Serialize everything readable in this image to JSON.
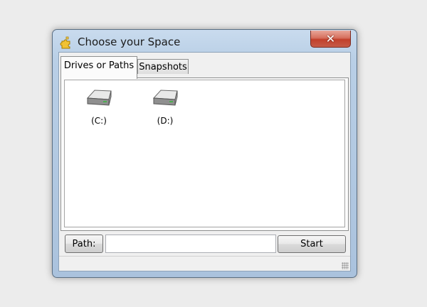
{
  "window": {
    "title": "Choose your Space",
    "close_symbol": "✕",
    "app_icon": "puzzle-piece-icon"
  },
  "tabs": [
    {
      "label": "Drives or Paths",
      "active": true
    },
    {
      "label": "Snapshots",
      "active": false
    }
  ],
  "drives": [
    {
      "label": "(C:)",
      "icon": "hard-drive-icon"
    },
    {
      "label": "(D:)",
      "icon": "hard-drive-icon"
    }
  ],
  "path": {
    "button_label": "Path:",
    "value": "",
    "placeholder": ""
  },
  "start_button": {
    "label": "Start"
  },
  "colors": {
    "titlebar": "#b9cfe6",
    "close_button": "#c2402b",
    "client_background": "#f0f0f0"
  }
}
